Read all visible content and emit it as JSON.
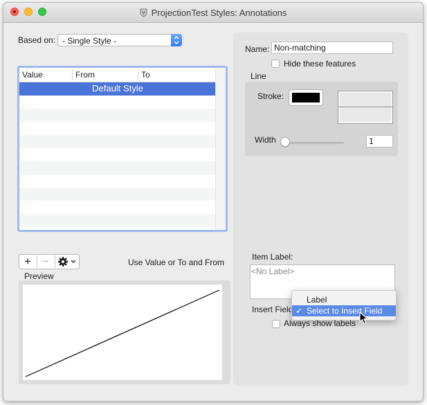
{
  "window": {
    "title": "ProjectionTest Styles: Annotations"
  },
  "left": {
    "based_on_label": "Based on:",
    "based_on_value": "- Single Style -",
    "table": {
      "columns": [
        "Value",
        "From",
        "To"
      ],
      "selected_row": "Default Style"
    },
    "add_button": "+",
    "remove_button": "−",
    "hint_text": "Use Value or To and From",
    "preview_label": "Preview"
  },
  "right": {
    "name_label": "Name:",
    "name_value": "Non-matching",
    "hide_label": "Hide these features",
    "line_group_label": "Line",
    "stroke_label": "Stroke:",
    "width_label": "Width",
    "width_value": "1",
    "width_slider_fraction": 0.0,
    "item_label_label": "Item Label:",
    "item_label_placeholder": "<No Label>",
    "insert_field_label": "Insert Field",
    "always_show_label": "Always show labels",
    "insert_menu": {
      "items": [
        "Label",
        "Select to Insert Field"
      ],
      "selected": "Select to Insert Field"
    }
  },
  "colors": {
    "stroke": "#000000",
    "selection": "#4a74d8",
    "menu_highlight": "#5b8ae6"
  }
}
